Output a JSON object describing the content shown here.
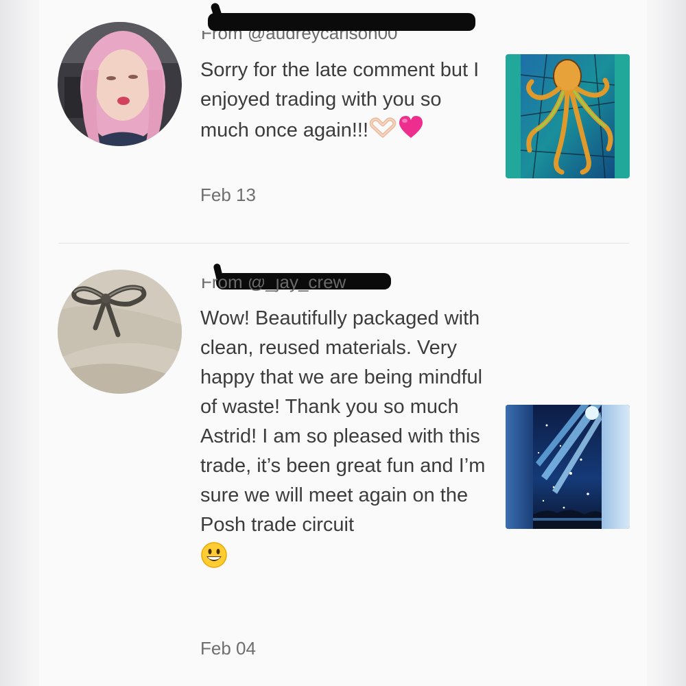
{
  "reviews": [
    {
      "from": "From @audreycarlson00",
      "message": "Sorry for the late comment but I enjoyed trading with you so much once again!!!",
      "emojis": [
        "heart-hands-emoji",
        "pink-heart-emoji"
      ],
      "date": "Feb 13",
      "avatar": "avatar-pink-hair",
      "thumbnail": "stained-glass-octopus-image"
    },
    {
      "from": "From @_jay_crew",
      "message": "Wow! Beautifully packaged with clean, reused materials. Very happy that we are being mindful of waste! Thank you so much Astrid! I am so pleased with this trade, it’s been great fun and I’m sure we will meet again on the Posh trade circuit",
      "emojis": [
        "grinning-face-emoji"
      ],
      "date": "Feb 04",
      "avatar": "avatar-bow-ring",
      "thumbnail": "starry-night-sky-image"
    }
  ]
}
